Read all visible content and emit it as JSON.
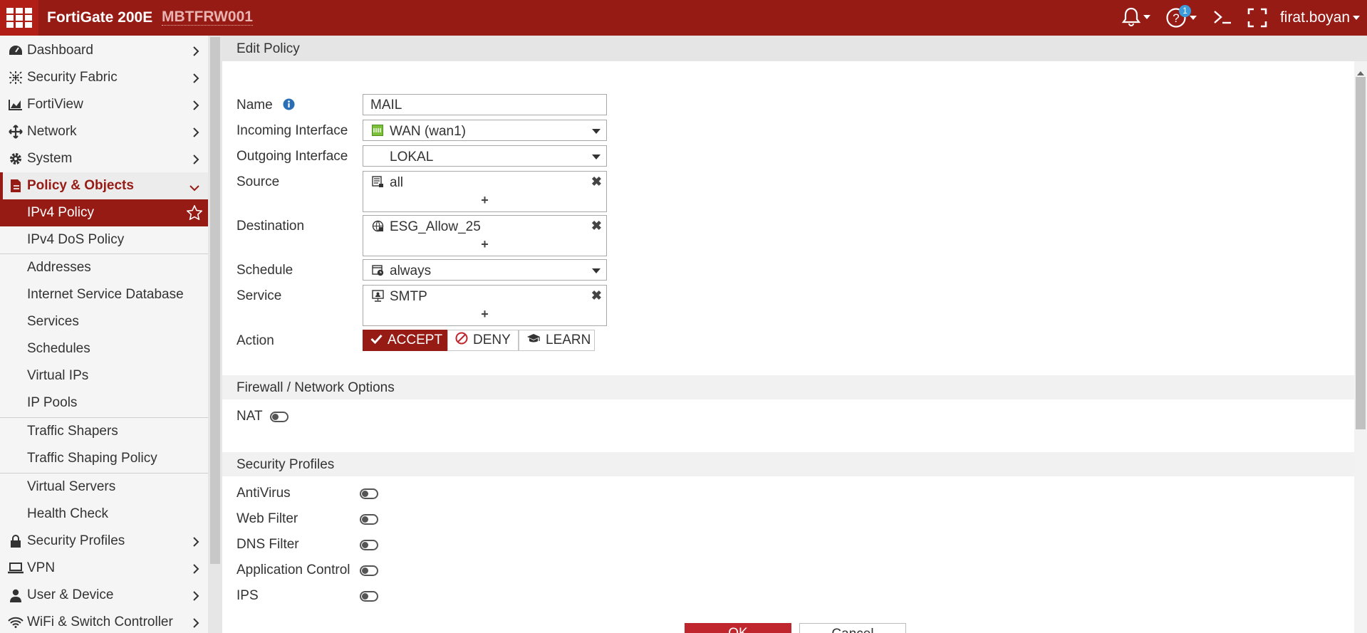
{
  "topbar": {
    "device_name": "FortiGate 200E",
    "hostname": "MBTFRW001",
    "help_badge_count": "1",
    "username": "firat.boyan",
    "icons": [
      "fortinet-logo-icon",
      "bell-icon",
      "help-icon",
      "cli-icon",
      "fullscreen-icon"
    ]
  },
  "sidebar": {
    "items": [
      {
        "label": "Dashboard",
        "icon": "dashboard-icon"
      },
      {
        "label": "Security Fabric",
        "icon": "fabric-icon"
      },
      {
        "label": "FortiView",
        "icon": "chart-icon"
      },
      {
        "label": "Network",
        "icon": "network-icon"
      },
      {
        "label": "System",
        "icon": "gear-icon"
      },
      {
        "label": "Policy & Objects",
        "icon": "policy-icon",
        "expanded": true
      }
    ],
    "sub_items": [
      {
        "label": "IPv4 Policy",
        "active": true
      },
      {
        "label": "IPv4 DoS Policy"
      },
      {
        "label": "Addresses"
      },
      {
        "label": "Internet Service Database"
      },
      {
        "label": "Services"
      },
      {
        "label": "Schedules"
      },
      {
        "label": "Virtual IPs"
      },
      {
        "label": "IP Pools"
      },
      {
        "label": "Traffic Shapers"
      },
      {
        "label": "Traffic Shaping Policy"
      },
      {
        "label": "Virtual Servers"
      },
      {
        "label": "Health Check"
      }
    ],
    "items_after": [
      {
        "label": "Security Profiles",
        "icon": "lock-icon"
      },
      {
        "label": "VPN",
        "icon": "laptop-icon"
      },
      {
        "label": "User & Device",
        "icon": "user-icon"
      },
      {
        "label": "WiFi & Switch Controller",
        "icon": "wifi-icon"
      }
    ]
  },
  "page": {
    "title": "Edit Policy"
  },
  "form": {
    "name": {
      "label": "Name",
      "value": "MAIL"
    },
    "incoming": {
      "label": "Incoming Interface",
      "value": "WAN (wan1)"
    },
    "outgoing": {
      "label": "Outgoing Interface",
      "value": "LOKAL"
    },
    "source": {
      "label": "Source",
      "value": "all",
      "add": "+"
    },
    "destination": {
      "label": "Destination",
      "value": "ESG_Allow_25",
      "add": "+"
    },
    "schedule": {
      "label": "Schedule",
      "value": "always"
    },
    "service": {
      "label": "Service",
      "value": "SMTP",
      "add": "+"
    },
    "action": {
      "label": "Action",
      "options": [
        "ACCEPT",
        "DENY",
        "LEARN"
      ],
      "selected": "ACCEPT"
    }
  },
  "sections": {
    "firewall": {
      "title": "Firewall / Network Options",
      "nat_label": "NAT",
      "nat_enabled": false
    },
    "security": {
      "title": "Security Profiles",
      "profiles": [
        {
          "label": "AntiVirus",
          "enabled": false
        },
        {
          "label": "Web Filter",
          "enabled": false
        },
        {
          "label": "DNS Filter",
          "enabled": false
        },
        {
          "label": "Application Control",
          "enabled": false
        },
        {
          "label": "IPS",
          "enabled": false
        }
      ]
    }
  },
  "footer": {
    "ok_label": "OK",
    "cancel_label": "Cancel"
  },
  "colors": {
    "brand": "#961b15",
    "accent_blue": "#3d9bd9"
  }
}
